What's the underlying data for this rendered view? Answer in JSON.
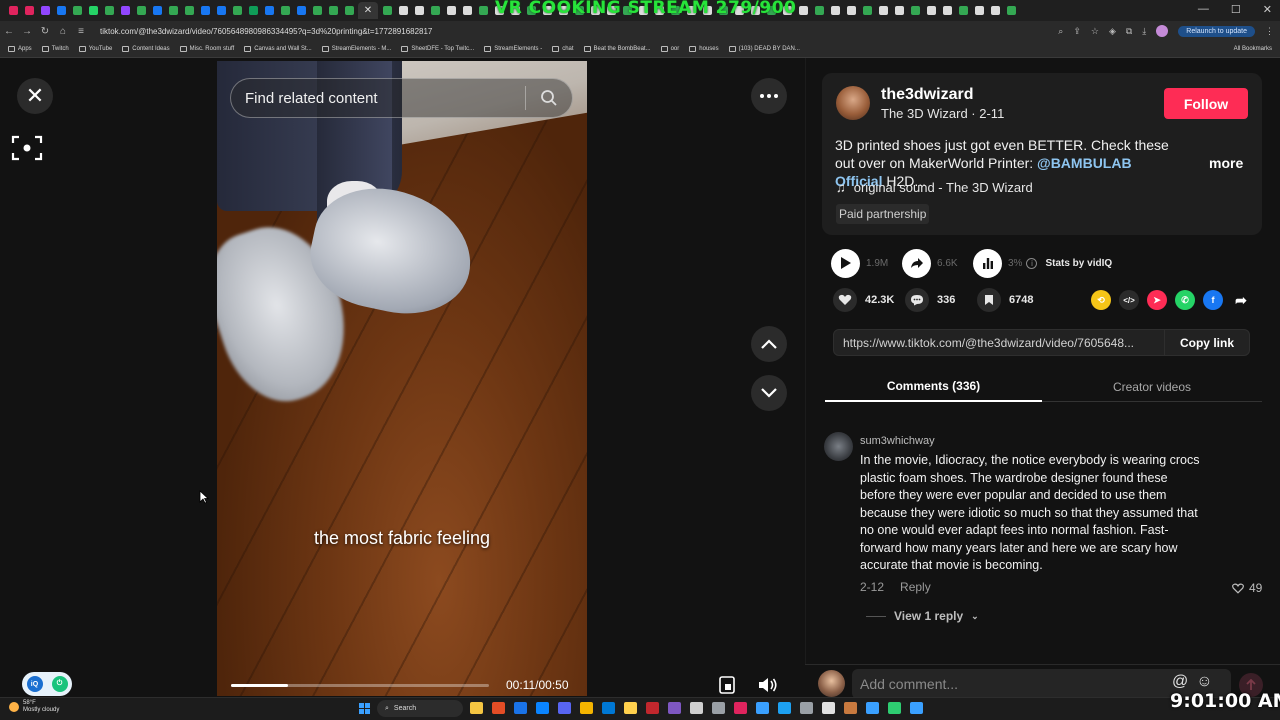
{
  "browser": {
    "overlay_text": "VR COOKING STREAM 279/900",
    "url": "tiktok.com/@the3dwizard/video/7605648980986334495?q=3d%20printing&t=1772891682817",
    "relaunch_label": "Relaunch to update",
    "bookmarks": [
      "Apps",
      "Twitch",
      "YouTube",
      "Content Ideas",
      "Misc. Room stuff",
      "Canvas and Wall St...",
      "StreamElements - M...",
      "SheetDFE - Top Twitc...",
      "StreamElements -",
      "chat",
      "Beat the BombBeat...",
      "oor",
      "houses",
      "(103) DEAD BY DAN..."
    ],
    "all_bookmarks_label": "All Bookmarks",
    "tab_colors": [
      "#e0245e",
      "#e0245e",
      "#9146ff",
      "#1877f2",
      "#34a853",
      "#25d366",
      "#34a853",
      "#9146ff",
      "#34a853",
      "#1877f2",
      "#34a853",
      "#34a853",
      "#1877f2",
      "#1877f2",
      "#34a853",
      "#0f9d58",
      "#1877f2",
      "#34a853",
      "#1877f2",
      "#34a853",
      "#34a853",
      "#34a853"
    ]
  },
  "video": {
    "search_placeholder": "Find related content",
    "caption": "the most fabric feeling",
    "timecode": "00:11/00:50",
    "progress_fraction": 0.22
  },
  "creator": {
    "username": "the3dwizard",
    "display_name": "The 3D Wizard",
    "date": "2-11",
    "subline": "The 3D Wizard · 2-11",
    "follow_label": "Follow",
    "description_pre": "3D printed shoes just got even BETTER. Check these out over on MakerWorld Printer: ",
    "mention": "@BAMBULAB Official",
    "description_post": " H2D...",
    "more_label": "more",
    "sound": "original sound - The 3D Wizard",
    "paid_label": "Paid partnership"
  },
  "stats": {
    "plays": "1.9M",
    "shares": "6.6K",
    "percent": "3%",
    "vidiq_label": "Stats by vidIQ"
  },
  "actions": {
    "likes": "42.3K",
    "comments": "336",
    "saves": "6748"
  },
  "link": {
    "url": "https://www.tiktok.com/@the3dwizard/video/7605648...",
    "copy_label": "Copy link"
  },
  "tabs": {
    "comments": "Comments (336)",
    "creator_videos": "Creator videos"
  },
  "comment": {
    "user": "sum3whichway",
    "text": "In the movie, Idiocracy, the notice everybody is wearing crocs plastic foam shoes. The wardrobe designer found these before they were ever popular and decided to use them because they were idiotic so much so that they assumed that no one would ever adapt fees into normal fashion. Fast-forward how many years later and here we are scary how accurate that movie is becoming.",
    "date": "2-12",
    "reply_label": "Reply",
    "likes": "49",
    "view_replies": "View 1 reply"
  },
  "compose": {
    "placeholder": "Add comment...",
    "at_symbol": "@",
    "emoji_symbol": "☺"
  },
  "taskbar": {
    "temp": "58°F",
    "weather": "Mostly cloudy",
    "search_label": "Search",
    "clock": "9:01:00 AM"
  }
}
